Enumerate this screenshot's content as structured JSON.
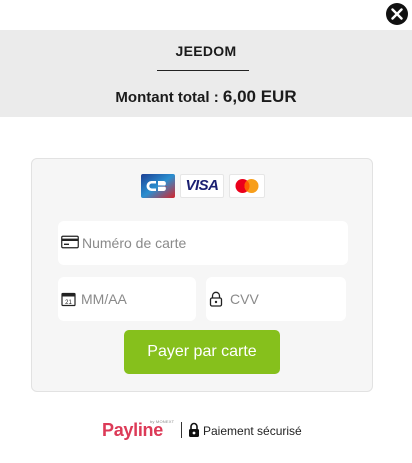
{
  "close_button": {
    "icon": "close-icon"
  },
  "header": {
    "merchant_name": "JEEDOM",
    "total_label": "Montant total :",
    "total_amount": "6,00 EUR"
  },
  "payment_form": {
    "card_brands": [
      {
        "icon": "cb-card-icon",
        "name": "CB"
      },
      {
        "icon": "visa-card-icon",
        "name": "VISA"
      },
      {
        "icon": "mastercard-card-icon",
        "name": "Mastercard"
      }
    ],
    "card_number": {
      "placeholder": "Numéro de carte",
      "value": "",
      "icon": "credit-card-icon"
    },
    "expiry": {
      "placeholder": "MM/AA",
      "value": "",
      "icon": "calendar-icon"
    },
    "cvv": {
      "placeholder": "CVV",
      "value": "",
      "icon": "lock-icon"
    },
    "submit_label": "Payer par carte",
    "accent_color": "#86c01c"
  },
  "footer": {
    "provider": "Payline",
    "provider_sub": "by MONEXT",
    "secure_text": "Paiement sécurisé",
    "provider_color": "#dc3a57"
  }
}
